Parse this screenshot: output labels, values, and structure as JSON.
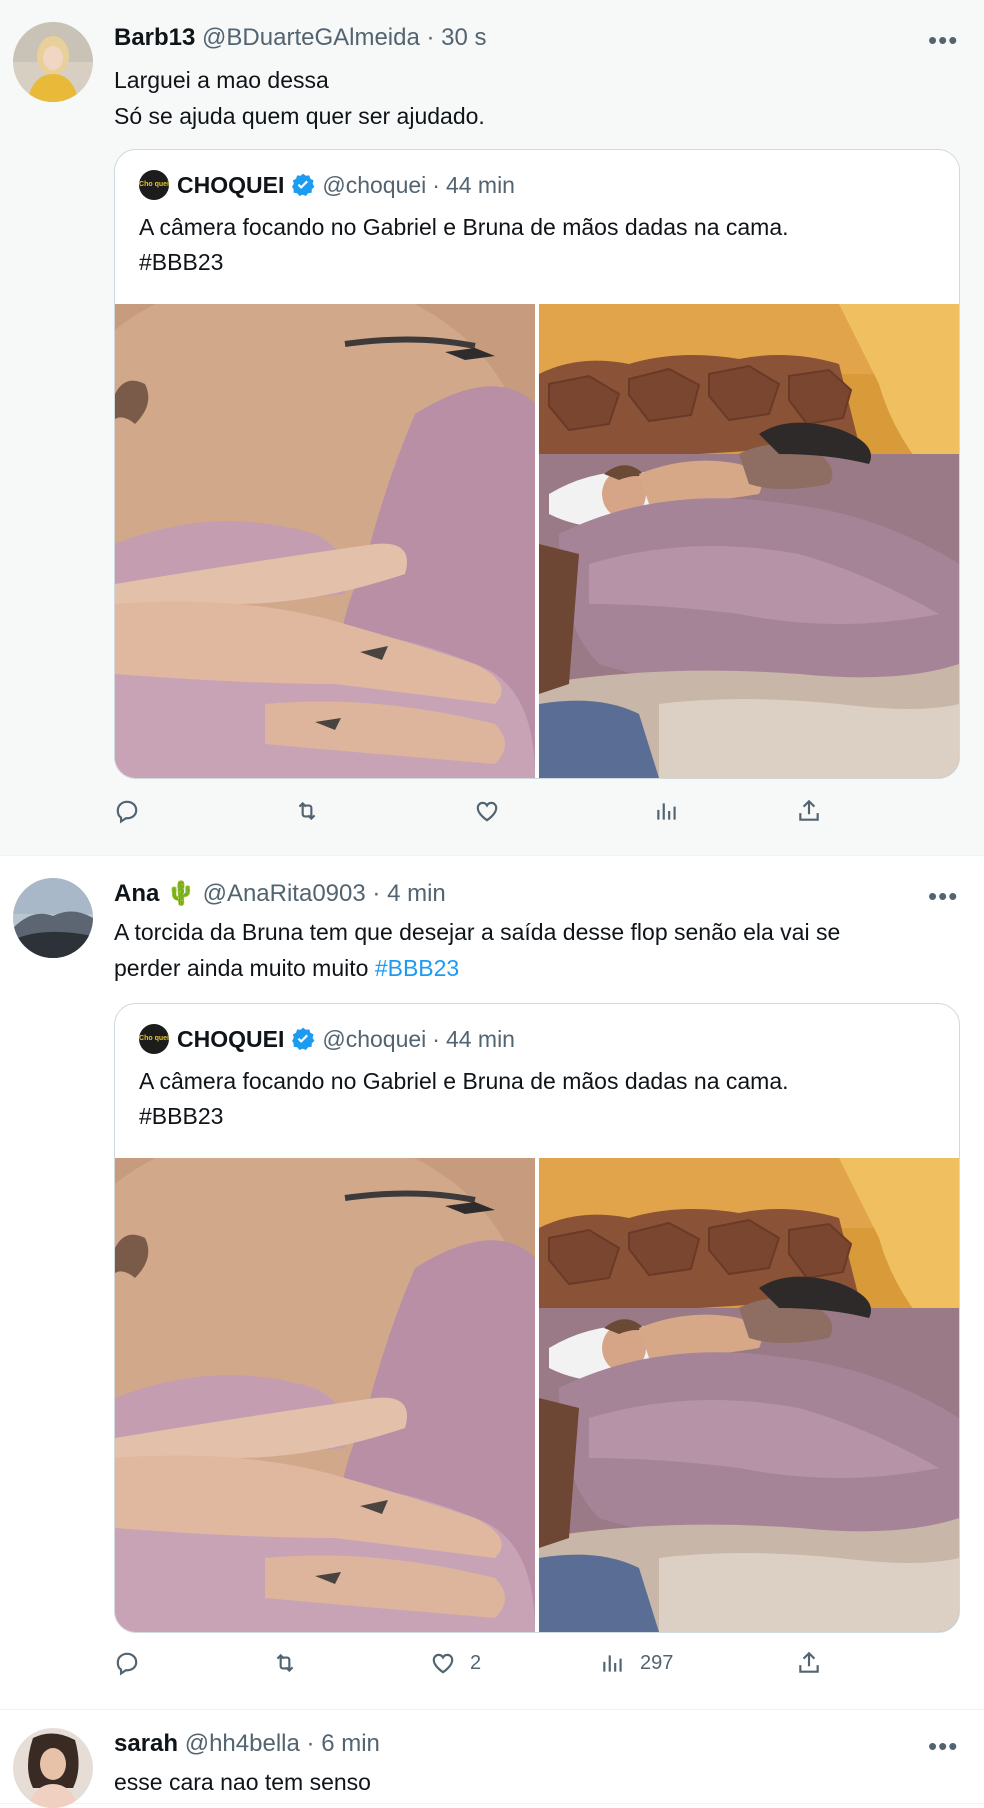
{
  "colors": {
    "text_primary": "#0f1419",
    "text_secondary": "#536471",
    "link": "#1d9bf0",
    "verified": "#1d9bf0",
    "border": "#cfd9de",
    "highlight_bg": "#f7f9f9"
  },
  "tweets": [
    {
      "name": "Barb13",
      "handle": "@BDuarteGAlmeida",
      "sep": "·",
      "time": "30 s",
      "more_icon": "more-horizontal-icon",
      "text_lines": [
        "Larguei a mao dessa",
        "Só se ajuda quem quer ser ajudado."
      ],
      "quote": {
        "name": "CHOQUEI",
        "avatar_text": "Cho quei",
        "handle": "@choquei",
        "sep": "·",
        "time": "44 min",
        "text_line1": "A câmera focando no Gabriel e Bruna de mãos dadas na cama.",
        "text_line2": "#BBB23"
      },
      "actions": {
        "reply": "",
        "retweet": "",
        "like": "",
        "views": ""
      }
    },
    {
      "name": "Ana",
      "emoji": "🌵",
      "handle": "@AnaRita0903",
      "sep": "·",
      "time": "4 min",
      "more_icon": "more-horizontal-icon",
      "text_line1": "A torcida da Bruna tem que desejar a saída desse flop senão ela vai se",
      "text_line2_plain": "perder ainda muito muito ",
      "text_line2_hashtag": "#BBB23",
      "quote": {
        "name": "CHOQUEI",
        "avatar_text": "Cho quei",
        "handle": "@choquei",
        "sep": "·",
        "time": "44 min",
        "text_line1": "A câmera focando no Gabriel e Bruna de mãos dadas na cama.",
        "text_line2": "#BBB23"
      },
      "actions": {
        "reply": "",
        "retweet": "",
        "like": "2",
        "views": "297"
      }
    },
    {
      "name": "sarah",
      "handle": "@hh4bella",
      "sep": "·",
      "time": "6 min",
      "more_icon": "more-horizontal-icon",
      "text_line1": "esse cara nao tem senso"
    }
  ]
}
